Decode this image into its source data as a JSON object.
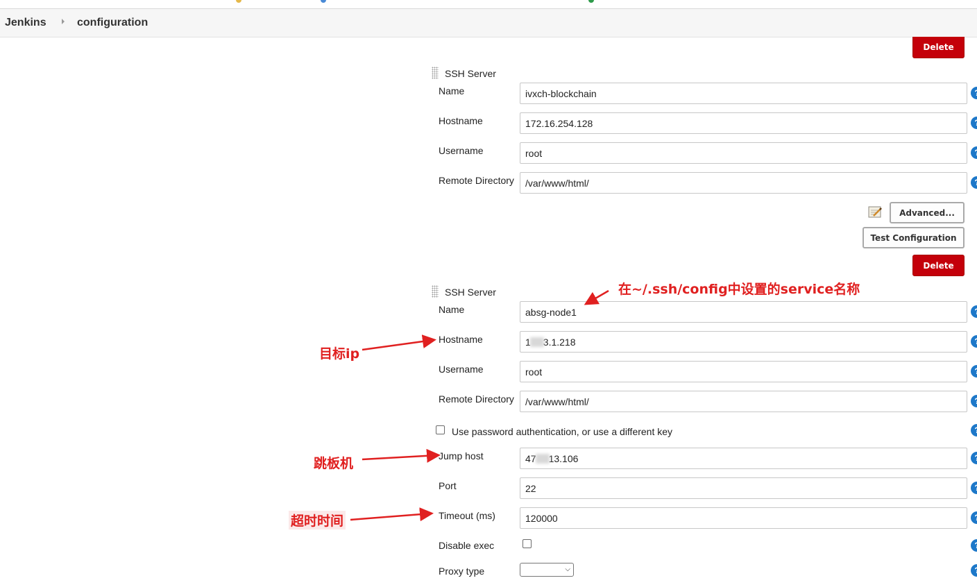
{
  "breadcrumb": {
    "root": "Jenkins",
    "page": "configuration"
  },
  "buttons": {
    "delete": "Delete",
    "advanced": "Advanced...",
    "test_configuration": "Test Configuration"
  },
  "server1": {
    "header": "SSH Server",
    "labels": {
      "name": "Name",
      "hostname": "Hostname",
      "username": "Username",
      "remote_directory": "Remote Directory"
    },
    "values": {
      "name": "ivxch-blockchain",
      "hostname": "172.16.254.128",
      "username": "root",
      "remote_directory": "/var/www/html/"
    }
  },
  "server2": {
    "header": "SSH Server",
    "labels": {
      "name": "Name",
      "hostname": "Hostname",
      "username": "Username",
      "remote_directory": "Remote Directory",
      "password_auth": "Use password authentication, or use a different key",
      "jump_host": "Jump host",
      "port": "Port",
      "timeout": "Timeout (ms)",
      "disable_exec": "Disable exec",
      "proxy_type": "Proxy type"
    },
    "values": {
      "name": "absg-node1",
      "hostname_prefix": "1",
      "hostname_suffix": "3.1.218",
      "username": "root",
      "remote_directory": "/var/www/html/",
      "jump_host_prefix": "47",
      "jump_host_suffix": "13.106",
      "port": "22",
      "timeout": "120000",
      "password_auth_checked": false,
      "disable_exec_checked": false,
      "proxy_type": ""
    }
  },
  "annotations": {
    "service_name": "在~/.ssh/config中设置的service名称",
    "target_ip": "目标ip",
    "jump_host": "跳板机",
    "timeout": "超时时间"
  },
  "help_icon": "?",
  "colors": {
    "delete_button": "#c4000a",
    "help_icon": "#1d78c9",
    "annotation": "#e02020"
  }
}
